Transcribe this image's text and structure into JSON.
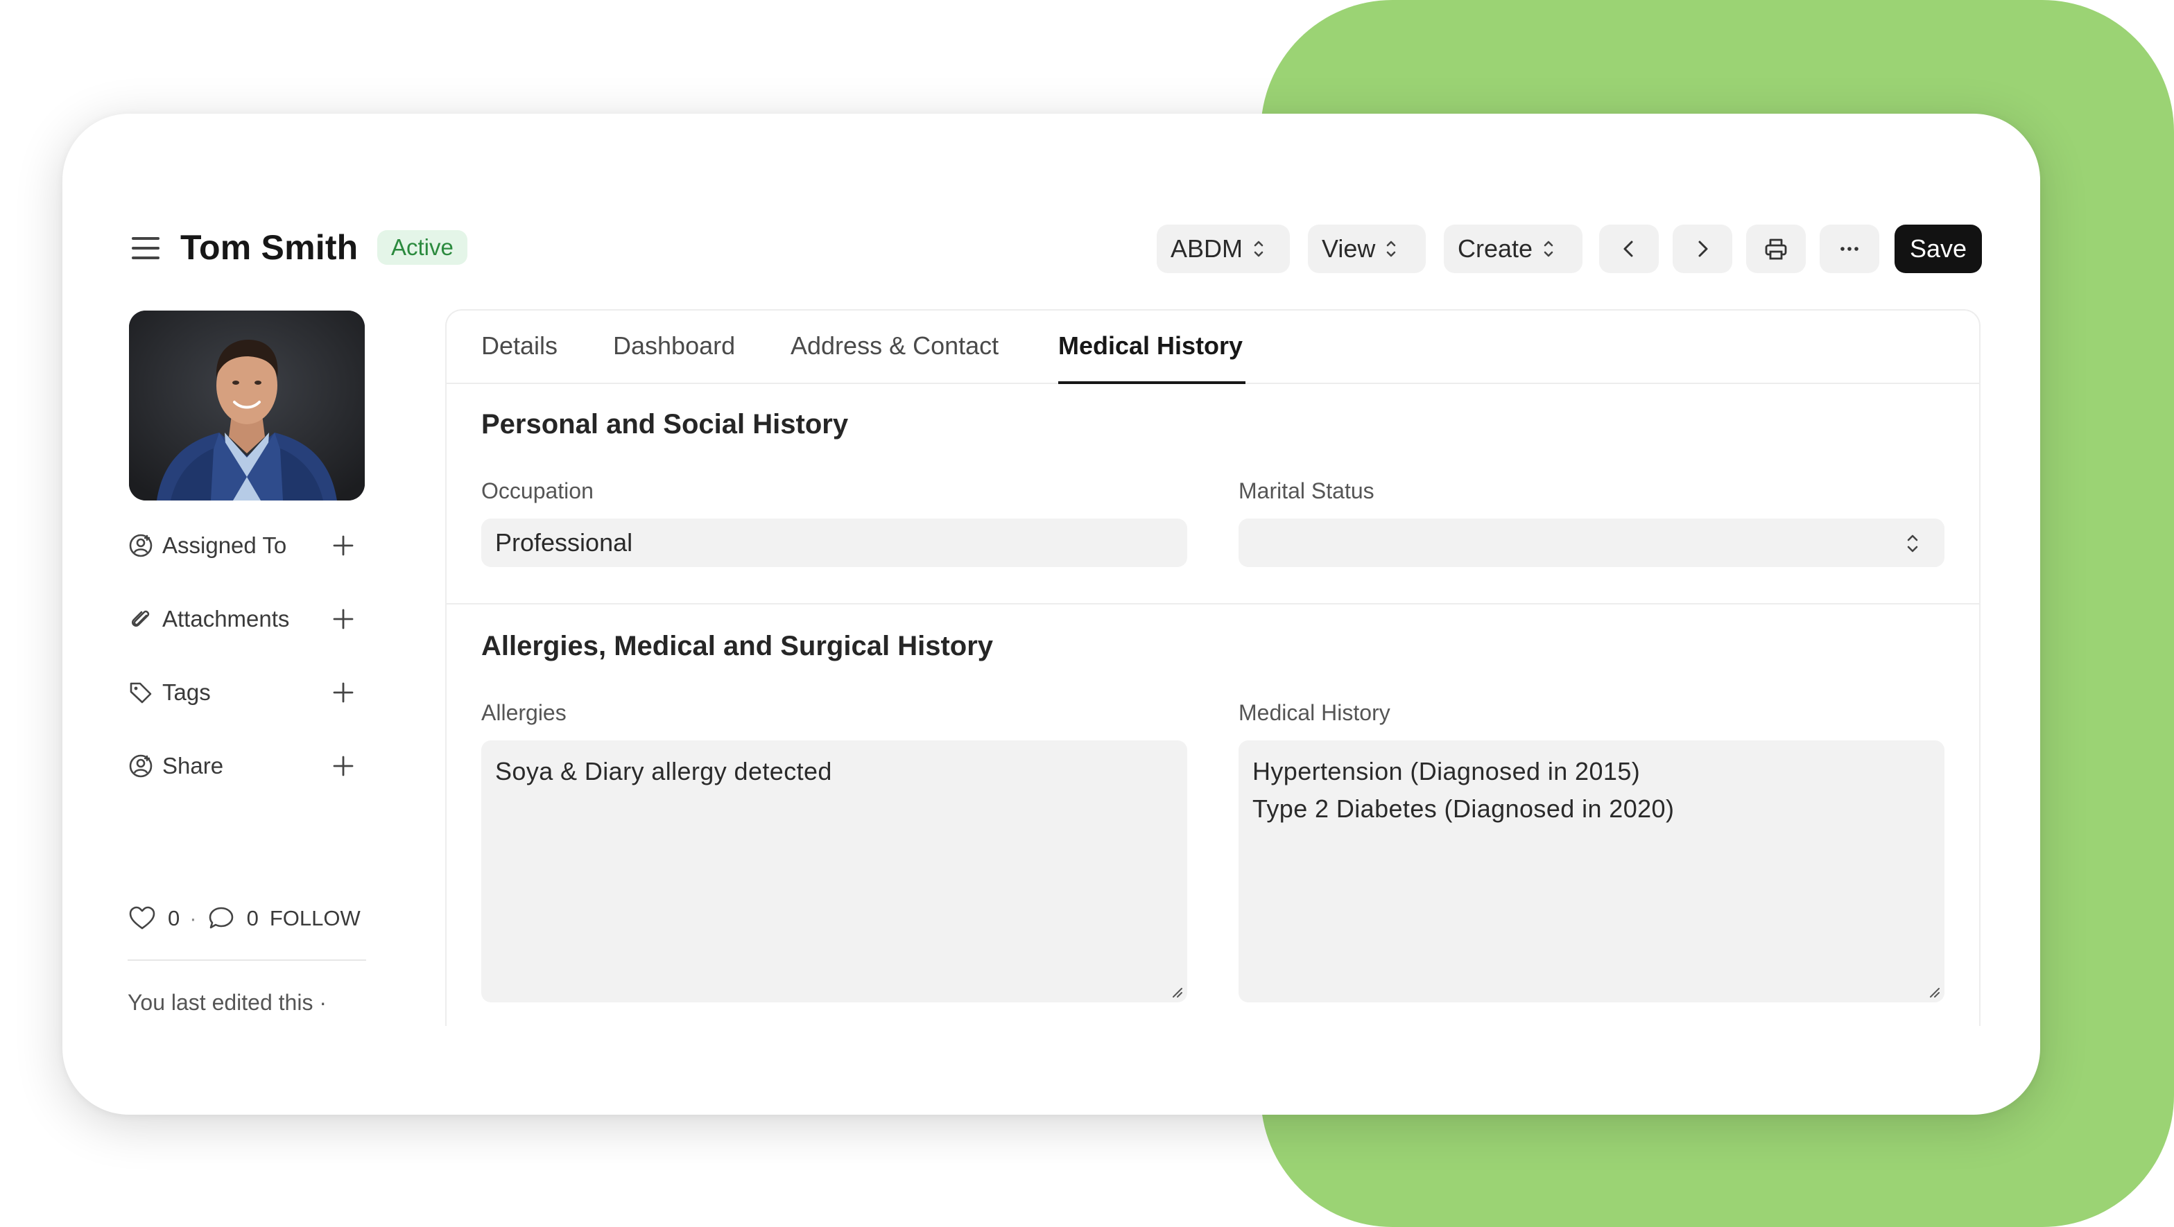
{
  "header": {
    "title": "Tom Smith",
    "status_badge": "Active",
    "toolbar": {
      "abdm_label": "ABDM",
      "view_label": "View",
      "create_label": "Create",
      "save_label": "Save"
    }
  },
  "sidebar": {
    "items": [
      {
        "label": "Assigned To",
        "icon": "user-assign-icon"
      },
      {
        "label": "Attachments",
        "icon": "paperclip-icon"
      },
      {
        "label": "Tags",
        "icon": "tag-icon"
      },
      {
        "label": "Share",
        "icon": "share-user-icon"
      }
    ],
    "likes_count": "0",
    "comments_count": "0",
    "follow_label": "FOLLOW",
    "last_edited": "You last edited this ·"
  },
  "tabs": [
    {
      "label": "Details",
      "active": false
    },
    {
      "label": "Dashboard",
      "active": false
    },
    {
      "label": "Address & Contact",
      "active": false
    },
    {
      "label": "Medical History",
      "active": true
    }
  ],
  "sections": {
    "personal": {
      "title": "Personal and Social History",
      "occupation_label": "Occupation",
      "occupation_value": "Professional",
      "marital_label": "Marital Status",
      "marital_value": ""
    },
    "medical": {
      "title": "Allergies, Medical and Surgical History",
      "allergies_label": "Allergies",
      "allergies_value": "Soya & Diary allergy detected",
      "history_label": "Medical History",
      "history_lines": [
        "Hypertension (Diagnosed in 2015)",
        "Type 2 Diabetes (Diagnosed in 2020)"
      ]
    }
  },
  "colors": {
    "background_accent": "#9bd374",
    "badge_bg": "#e4f5e8",
    "badge_text": "#2b8a3e",
    "primary_button": "#121212"
  }
}
